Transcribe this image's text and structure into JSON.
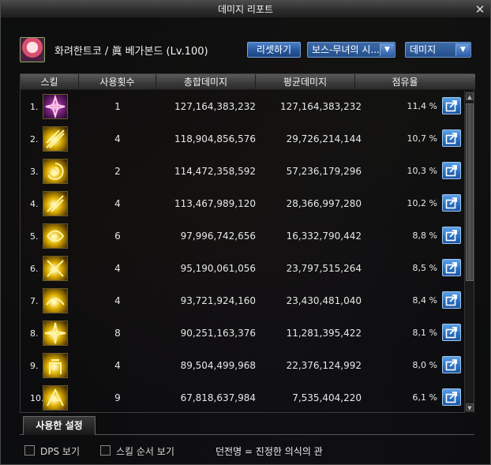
{
  "window": {
    "title": "데미지 리포트",
    "close_glyph": "✕"
  },
  "character": {
    "name": "화려한트코 / 眞 베가본드 (Lv.100)"
  },
  "controls": {
    "reset_label": "리셋하기",
    "boss_select": "보스-무녀의 시...",
    "type_select": "데미지",
    "dropdown_glyph": "▼"
  },
  "table": {
    "headers": {
      "skill": "스킬",
      "count": "사용횟수",
      "total": "총합데미지",
      "average": "평균데미지",
      "share": "점유율"
    },
    "rows": [
      {
        "rank": "1.",
        "count": "1",
        "total": "127,164,383,232",
        "average": "127,164,383,232",
        "share": "11,4  %",
        "icon": "skill-icon-purple"
      },
      {
        "rank": "2.",
        "count": "4",
        "total": "118,904,856,576",
        "average": "29,726,214,144",
        "share": "10,7  %",
        "icon": "skill-icon-gold-burst"
      },
      {
        "rank": "3.",
        "count": "2",
        "total": "114,472,358,592",
        "average": "57,236,179,296",
        "share": "10,3  %",
        "icon": "skill-icon-gold-swirl"
      },
      {
        "rank": "4.",
        "count": "4",
        "total": "113,467,989,120",
        "average": "28,366,997,280",
        "share": "10,2  %",
        "icon": "skill-icon-gold-slash"
      },
      {
        "rank": "5.",
        "count": "6",
        "total": "97,996,742,656",
        "average": "16,332,790,442",
        "share": "8,8  %",
        "icon": "skill-icon-gold-spin"
      },
      {
        "rank": "6.",
        "count": "4",
        "total": "95,190,061,056",
        "average": "23,797,515,264",
        "share": "8,5  %",
        "icon": "skill-icon-gold-cross"
      },
      {
        "rank": "7.",
        "count": "4",
        "total": "93,721,924,160",
        "average": "23,430,481,040",
        "share": "8,4  %",
        "icon": "skill-icon-gold-wave"
      },
      {
        "rank": "8.",
        "count": "8",
        "total": "90,251,163,376",
        "average": "11,281,395,422",
        "share": "8,1  %",
        "icon": "skill-icon-gold-star"
      },
      {
        "rank": "9.",
        "count": "4",
        "total": "89,504,499,968",
        "average": "22,376,124,992",
        "share": "8,0  %",
        "icon": "skill-icon-gold-fist"
      },
      {
        "rank": "10.",
        "count": "9",
        "total": "67,818,637,984",
        "average": "7,535,404,220",
        "share": "6,1  %",
        "icon": "skill-icon-gold-strike"
      }
    ]
  },
  "tabs": {
    "used_settings": "사용한 설정"
  },
  "footer": {
    "dps_label": "DPS 보기",
    "skill_order_label": "스킬 순서 보기",
    "dungeon": "던전명 = 진정한 의식의 관"
  },
  "colors": {
    "accent_blue": "#2a5aa0",
    "icon_gold": "#e0b000",
    "icon_purple": "#8a2a8a"
  }
}
